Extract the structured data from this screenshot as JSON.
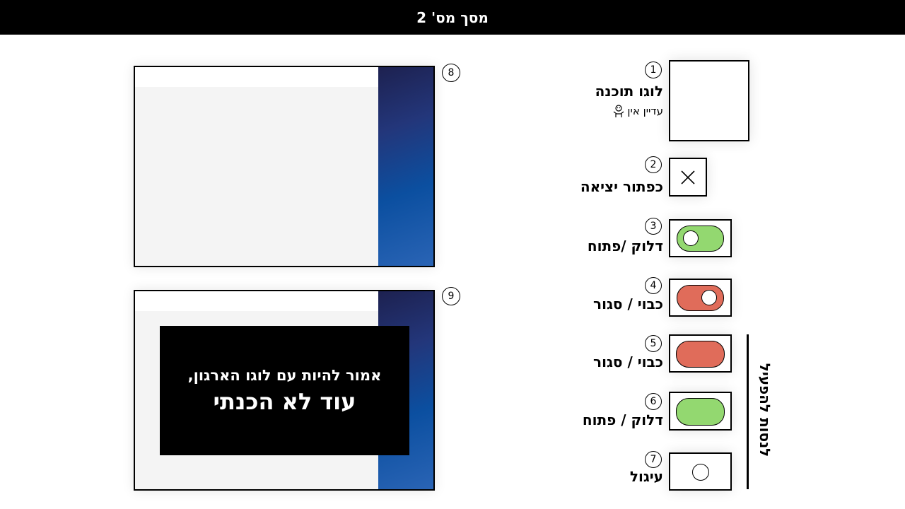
{
  "header": {
    "title": "מסך מס' 2"
  },
  "items": [
    {
      "num": "1",
      "label": "לוגו תוכנה",
      "sublabel": "עדיין אין"
    },
    {
      "num": "2",
      "label": "כפתור יציאה"
    },
    {
      "num": "3",
      "label": "דלוק /פתוח"
    },
    {
      "num": "4",
      "label": "כבוי / סגור"
    },
    {
      "num": "5",
      "label": "כבוי / סגור"
    },
    {
      "num": "6",
      "label": "דלוק / פתוח"
    },
    {
      "num": "7",
      "label": "עיגול"
    }
  ],
  "side_label": "לנסות להפעיל",
  "screens": [
    {
      "num": "8"
    },
    {
      "num": "9",
      "overlay_line1": "אמור להיות עם לוגו הארגון,",
      "overlay_line2": "עוד לא הכנתי"
    }
  ],
  "colors": {
    "green": "#93d870",
    "green_alt": "#8fcf6a",
    "red": "#e06c5a",
    "header_bg": "#000000"
  },
  "icons": [
    "close-icon",
    "shrug-icon"
  ]
}
